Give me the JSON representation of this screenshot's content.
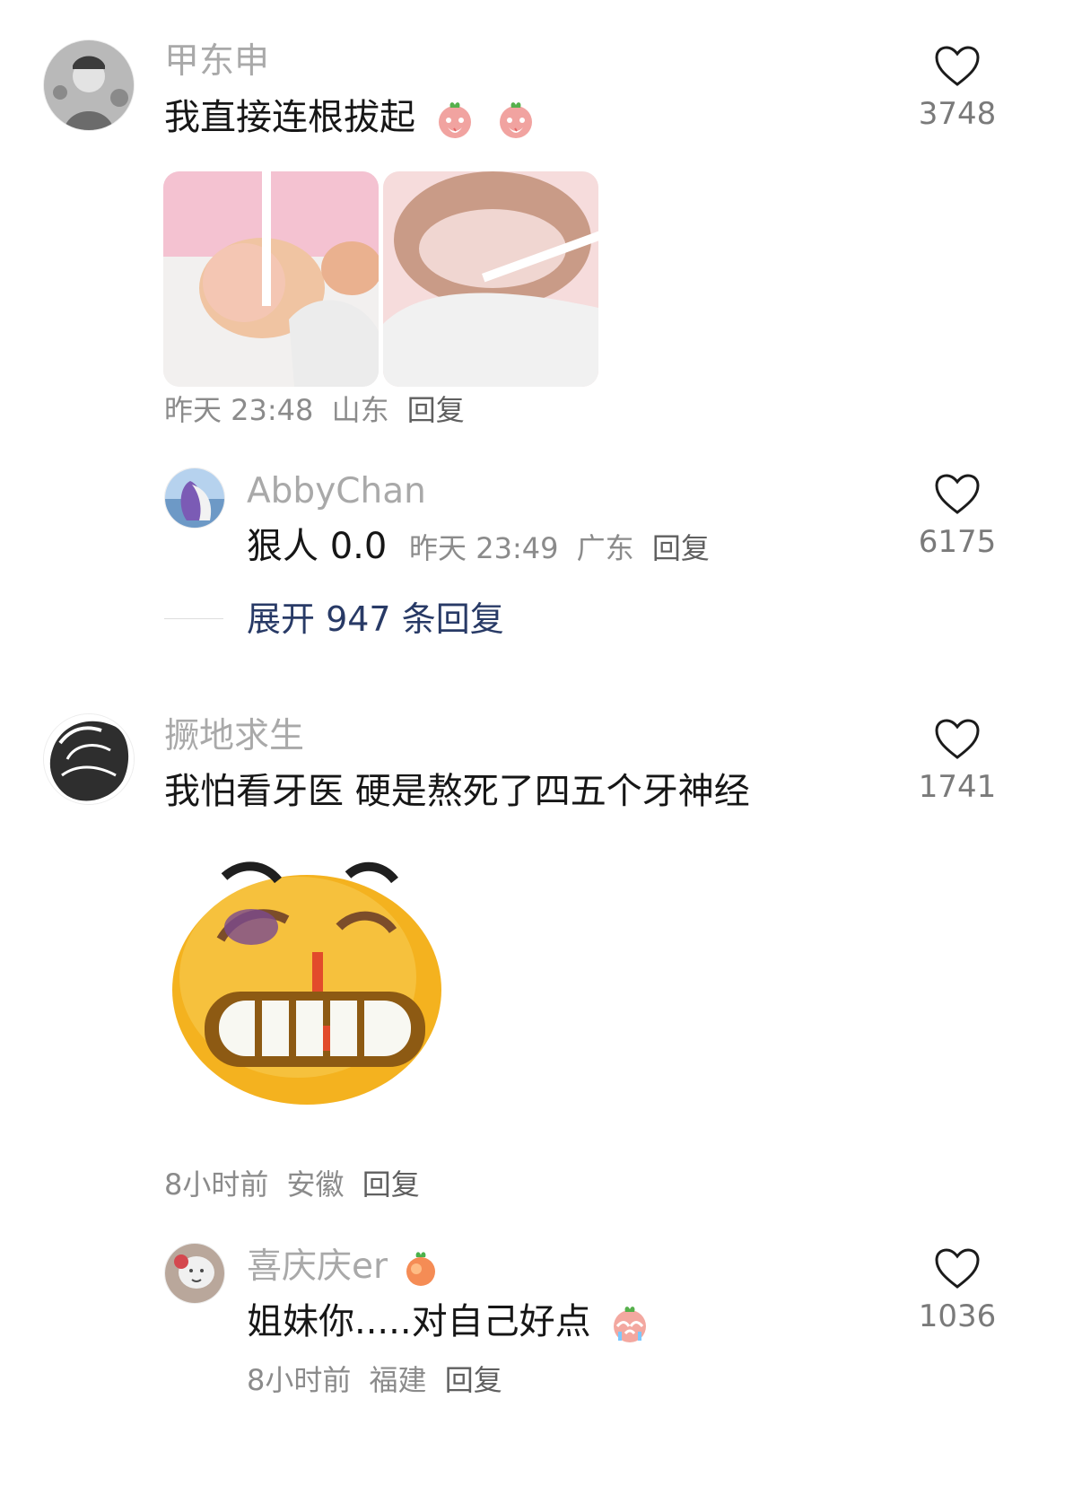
{
  "comments": [
    {
      "user": "甲东申",
      "text": "我直接连根拔起",
      "emoji_icons": [
        "peach-crying-icon",
        "peach-crying-icon"
      ],
      "images": [
        "toenail-photo-1",
        "toenail-photo-2"
      ],
      "time": "昨天 23:48",
      "location": "山东",
      "reply_label": "回复",
      "likes": "3748",
      "replies": [
        {
          "user": "AbbyChan",
          "text": "狠人 0.0",
          "time": "昨天 23:49",
          "location": "广东",
          "reply_label": "回复",
          "likes": "6175"
        }
      ],
      "expand_label": "展开 947 条回复"
    },
    {
      "user": "撅地求生",
      "text": "我怕看牙医 硬是熬死了四五个牙神经",
      "image": "bruised-grin-sticker",
      "time": "8小时前",
      "location": "安徽",
      "reply_label": "回复",
      "likes": "1741",
      "replies": [
        {
          "user": "喜庆庆er",
          "name_emoji": "peach-icon",
          "text": "姐妹你.....对自己好点",
          "emoji_icons": [
            "peach-crying-icon"
          ],
          "time": "8小时前",
          "location": "福建",
          "reply_label": "回复",
          "likes": "1036"
        }
      ]
    }
  ],
  "icons": {
    "like": "heart-outline-icon"
  }
}
